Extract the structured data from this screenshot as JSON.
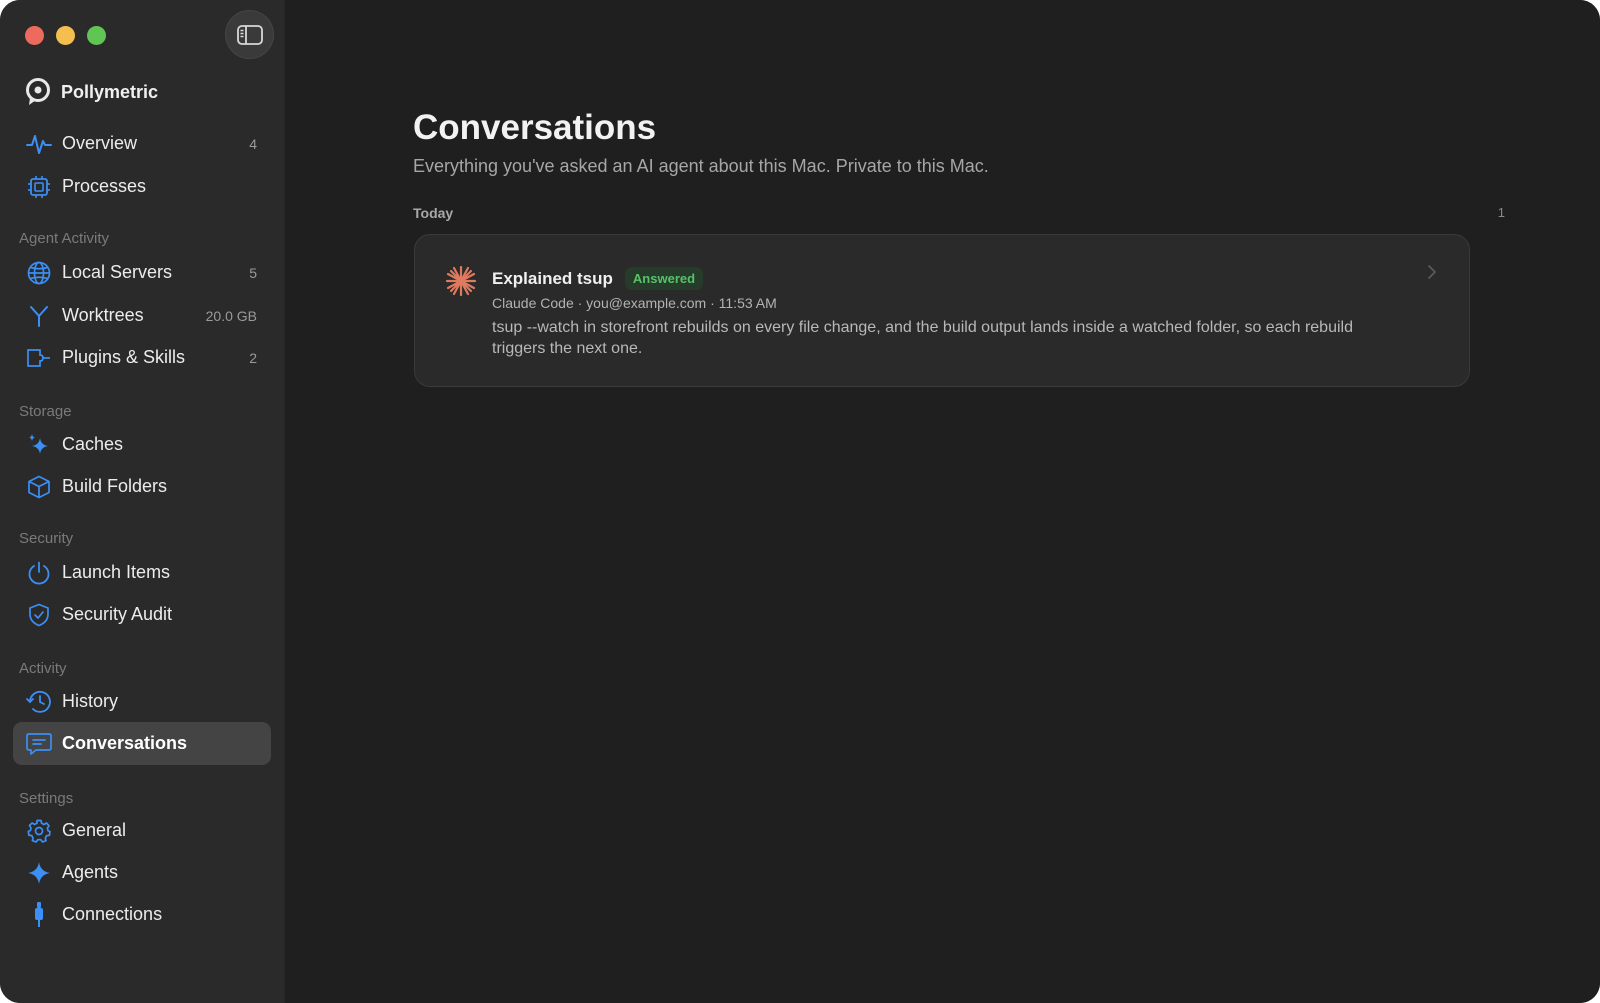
{
  "app": {
    "name": "Pollymetric"
  },
  "colors": {
    "accent": "#3b8ff5",
    "badge_green": "#57c26a",
    "agent_icon": "#e07a5f"
  },
  "sidebar": {
    "items": [
      {
        "label": "Overview",
        "count": "4",
        "icon": "activity-icon"
      },
      {
        "label": "Processes",
        "count": "",
        "icon": "cpu-chip-icon"
      },
      {
        "label": "Local Servers",
        "count": "5",
        "icon": "globe-icon"
      },
      {
        "label": "Worktrees",
        "count": "20.0 GB",
        "icon": "branch-icon"
      },
      {
        "label": "Plugins & Skills",
        "count": "2",
        "icon": "plugin-icon"
      },
      {
        "label": "Caches",
        "count": "",
        "icon": "sparkles-icon"
      },
      {
        "label": "Build Folders",
        "count": "",
        "icon": "cube-icon"
      },
      {
        "label": "Launch Items",
        "count": "",
        "icon": "power-icon"
      },
      {
        "label": "Security Audit",
        "count": "",
        "icon": "shield-check-icon"
      },
      {
        "label": "History",
        "count": "",
        "icon": "history-icon"
      },
      {
        "label": "Conversations",
        "count": "",
        "icon": "chat-bubble-icon"
      },
      {
        "label": "General",
        "count": "",
        "icon": "gear-icon"
      },
      {
        "label": "Agents",
        "count": "",
        "icon": "sparkle-icon"
      },
      {
        "label": "Connections",
        "count": "",
        "icon": "plug-icon"
      }
    ],
    "sections": {
      "agent_activity": "Agent Activity",
      "storage": "Storage",
      "security": "Security",
      "activity": "Activity",
      "settings": "Settings"
    },
    "active": "Conversations"
  },
  "main": {
    "title": "Conversations",
    "subtitle": "Everything you've asked an AI agent about this Mac. Private to this Mac.",
    "groups": [
      {
        "label": "Today",
        "count": "1",
        "conversations": [
          {
            "title": "Explained tsup",
            "status": "Answered",
            "meta": "Claude Code · you@example.com · 11:53 AM",
            "body": "tsup --watch in storefront rebuilds on every file change, and the build output lands inside a watched folder, so each rebuild triggers the next one."
          }
        ]
      }
    ]
  }
}
